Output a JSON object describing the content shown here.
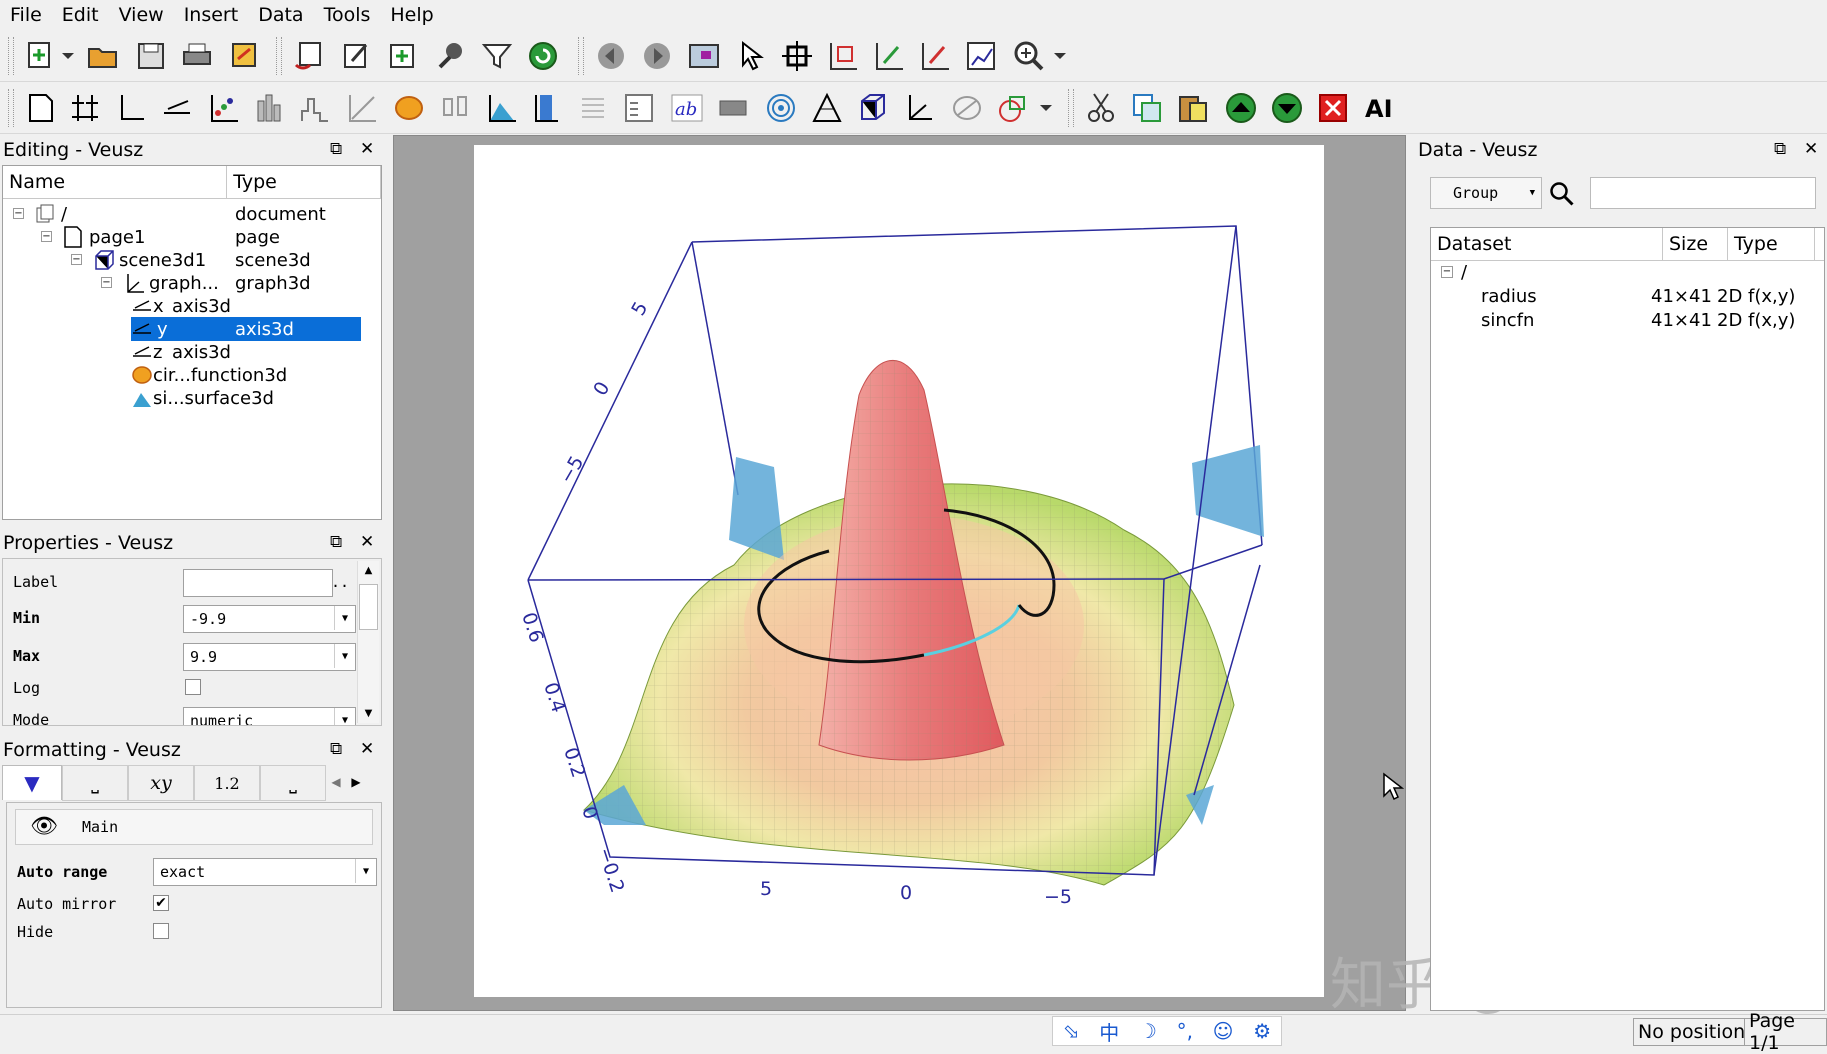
{
  "menu": [
    "File",
    "Edit",
    "View",
    "Insert",
    "Data",
    "Tools",
    "Help"
  ],
  "editing_panel": {
    "title": "Editing - Veusz",
    "columns": [
      "Name",
      "Type"
    ],
    "rows": [
      {
        "name": "/",
        "type": "document",
        "icon": "document-icon"
      },
      {
        "name": "page1",
        "type": "page",
        "icon": "page-icon"
      },
      {
        "name": "scene3d1",
        "type": "scene3d",
        "icon": "scene3d-icon"
      },
      {
        "name": "graph...",
        "type": "graph3d",
        "icon": "graph3d-icon"
      },
      {
        "name": "x",
        "type": "axis3d",
        "icon": "axis-icon"
      },
      {
        "name": "y",
        "type": "axis3d",
        "icon": "axis-icon",
        "selected": true
      },
      {
        "name": "z",
        "type": "axis3d",
        "icon": "axis-icon"
      },
      {
        "name": "cir...",
        "type": "function3d",
        "icon": "function3d-icon"
      },
      {
        "name": "si...",
        "type": "surface3d",
        "icon": "surface3d-icon"
      }
    ]
  },
  "properties_panel": {
    "title": "Properties - Veusz",
    "rows": [
      {
        "label": "Label",
        "value": "",
        "bold": false,
        "extra": ".."
      },
      {
        "label": "Min",
        "value": "-9.9",
        "bold": true
      },
      {
        "label": "Max",
        "value": "9.9",
        "bold": true
      },
      {
        "label": "Log",
        "value": "",
        "bold": false
      },
      {
        "label": "Mode",
        "value": "numeric",
        "bold": false
      }
    ]
  },
  "formatting_panel": {
    "title": "Formatting - Veusz",
    "tabs": [
      "▼",
      "⎵",
      "xy",
      "1.2",
      "⎵"
    ],
    "section": "Main",
    "rows": [
      {
        "label": "Auto range",
        "value": "exact",
        "bold": true
      },
      {
        "label": "Auto mirror",
        "checked": true
      },
      {
        "label": "Hide",
        "checked": false
      }
    ]
  },
  "data_panel": {
    "title": "Data - Veusz",
    "group_label": "Group",
    "search_value": "",
    "columns": [
      "Dataset",
      "Size",
      "Type"
    ],
    "root": "/",
    "datasets": [
      {
        "name": "radius",
        "size": "41×41",
        "type": "2D f(x,y)"
      },
      {
        "name": "sincfn",
        "size": "41×41",
        "type": "2D f(x,y)"
      }
    ]
  },
  "plot": {
    "x_ticks": [
      "5",
      "0",
      "−5"
    ],
    "y_ticks": [
      "5",
      "0",
      "−5"
    ],
    "z_ticks": [
      "0.6",
      "0.4",
      "0.2",
      "0",
      "−0.2"
    ],
    "colors": {
      "peak": "#e05a5e",
      "mid": "#f2c9a0",
      "low": "#b8d96a",
      "edge": "#5aa7d6",
      "axis": "#2a2a9c"
    }
  },
  "status": {
    "position": "No position",
    "page": "Page 1/1"
  },
  "ime": [
    "中",
    "☽",
    "°,",
    "☺",
    "⚙"
  ],
  "watermark": "知乎 @大猫爱吃鱼"
}
